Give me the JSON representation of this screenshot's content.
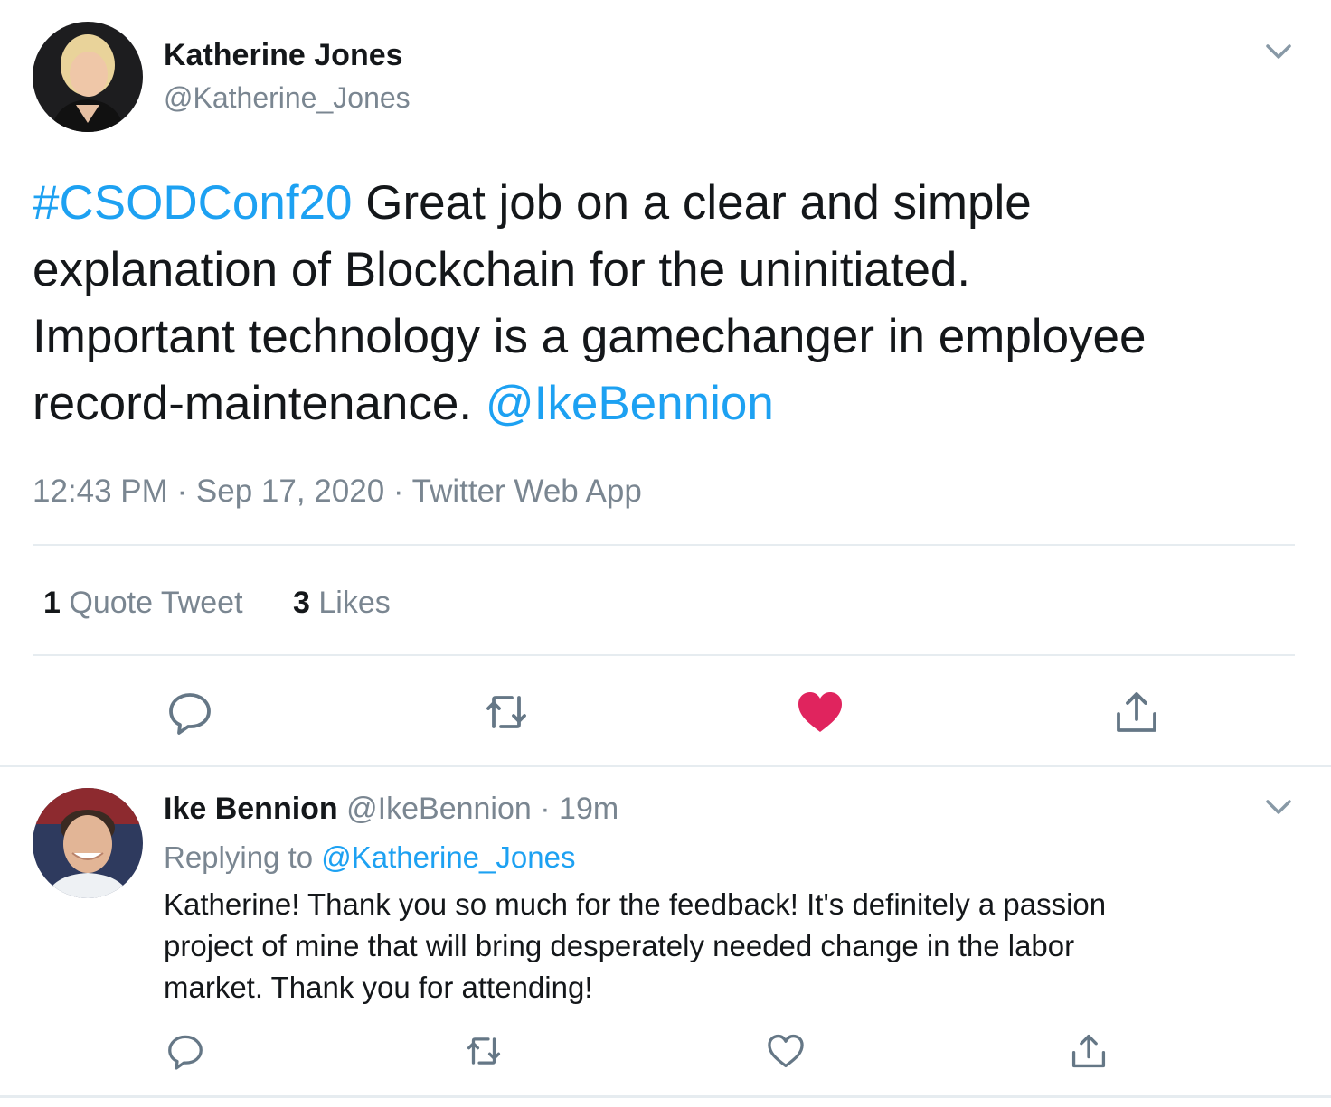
{
  "tweet": {
    "author_name": "Katherine Jones",
    "author_handle": "@Katherine_Jones",
    "hashtag": "#CSODConf20",
    "text_line1": " Great job on a clear and simple",
    "text_line2": "explanation of Blockchain for the uninitiated.",
    "text_line3": "Important technology is a gamechanger in employee",
    "text_line4": "record-maintenance. ",
    "mention": "@IkeBennion",
    "timestamp": "12:43 PM · Sep 17, 2020 · Twitter Web App",
    "stats": {
      "quote_count": "1",
      "quote_label": "Quote Tweet",
      "like_count": "3",
      "like_label": "Likes"
    },
    "liked": true,
    "icons": [
      "chevron-down-icon",
      "reply-icon",
      "retweet-icon",
      "heart-filled-icon",
      "share-icon"
    ]
  },
  "reply": {
    "author_name": "Ike Bennion",
    "author_handle": "@IkeBennion",
    "separator": "·",
    "time": "19m",
    "replying_prefix": "Replying to ",
    "replying_to": "@Katherine_Jones",
    "text_line1": "Katherine! Thank you so much for the feedback! It's definitely a passion",
    "text_line2": "project of mine that will bring desperately needed change in the labor",
    "text_line3": "market. Thank you for attending!",
    "icons": [
      "chevron-down-icon",
      "reply-icon",
      "retweet-icon",
      "heart-outline-icon",
      "share-icon"
    ]
  },
  "colors": {
    "link": "#1da1f2",
    "like": "#e0245e",
    "muted": "#7a8691",
    "divider": "#e6ecf0"
  }
}
